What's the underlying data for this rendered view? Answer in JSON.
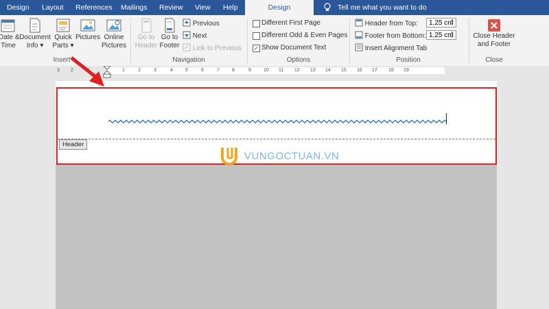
{
  "tabs": [
    "Design",
    "Layout",
    "References",
    "Mailings",
    "Review",
    "View",
    "Help",
    "Design"
  ],
  "tell_me": "Tell me what you want to do",
  "insert_group": {
    "date_time": [
      "Date &",
      "Time"
    ],
    "document_info": [
      "Document",
      "Info ▾"
    ],
    "quick_parts": [
      "Quick",
      "Parts ▾"
    ],
    "pictures": "Pictures",
    "online_pictures": [
      "Online",
      "Pictures"
    ],
    "label": "Insert"
  },
  "navigation_group": {
    "go_to_header": [
      "Go to",
      "Header"
    ],
    "go_to_footer": [
      "Go to",
      "Footer"
    ],
    "previous": "Previous",
    "next": "Next",
    "link_to_previous": "Link to Previous",
    "label": "Navigation"
  },
  "options_group": {
    "different_first_page": "Different First Page",
    "different_odd_even": "Different Odd & Even Pages",
    "show_document_text": "Show Document Text",
    "label": "Options"
  },
  "position_group": {
    "header_from_top": "Header from Top:",
    "header_from_top_value": "1,25 cm",
    "footer_from_bottom": "Footer from Bottom:",
    "footer_from_bottom_value": "1,25 cm",
    "insert_alignment_tab": "Insert Alignment Tab",
    "label": "Position"
  },
  "close_group": {
    "close_button": [
      "Close Header",
      "and Footer"
    ],
    "label": "Close"
  },
  "ruler_marks": [
    "3",
    "2",
    "1",
    "1",
    "2",
    "3",
    "4",
    "5",
    "6",
    "7",
    "8",
    "9",
    "10",
    "11",
    "12",
    "13",
    "14",
    "15",
    "16",
    "17",
    "18",
    "19"
  ],
  "document": {
    "header_tag": "Header",
    "watermark": "VUNGOCTUAN.VN"
  },
  "colors": {
    "word_blue": "#2b579a",
    "highlight_red": "#e02020",
    "squiggle_blue": "#2e6fb0",
    "watermark_orange": "#f4a51c",
    "close_red": "#d9534f"
  }
}
